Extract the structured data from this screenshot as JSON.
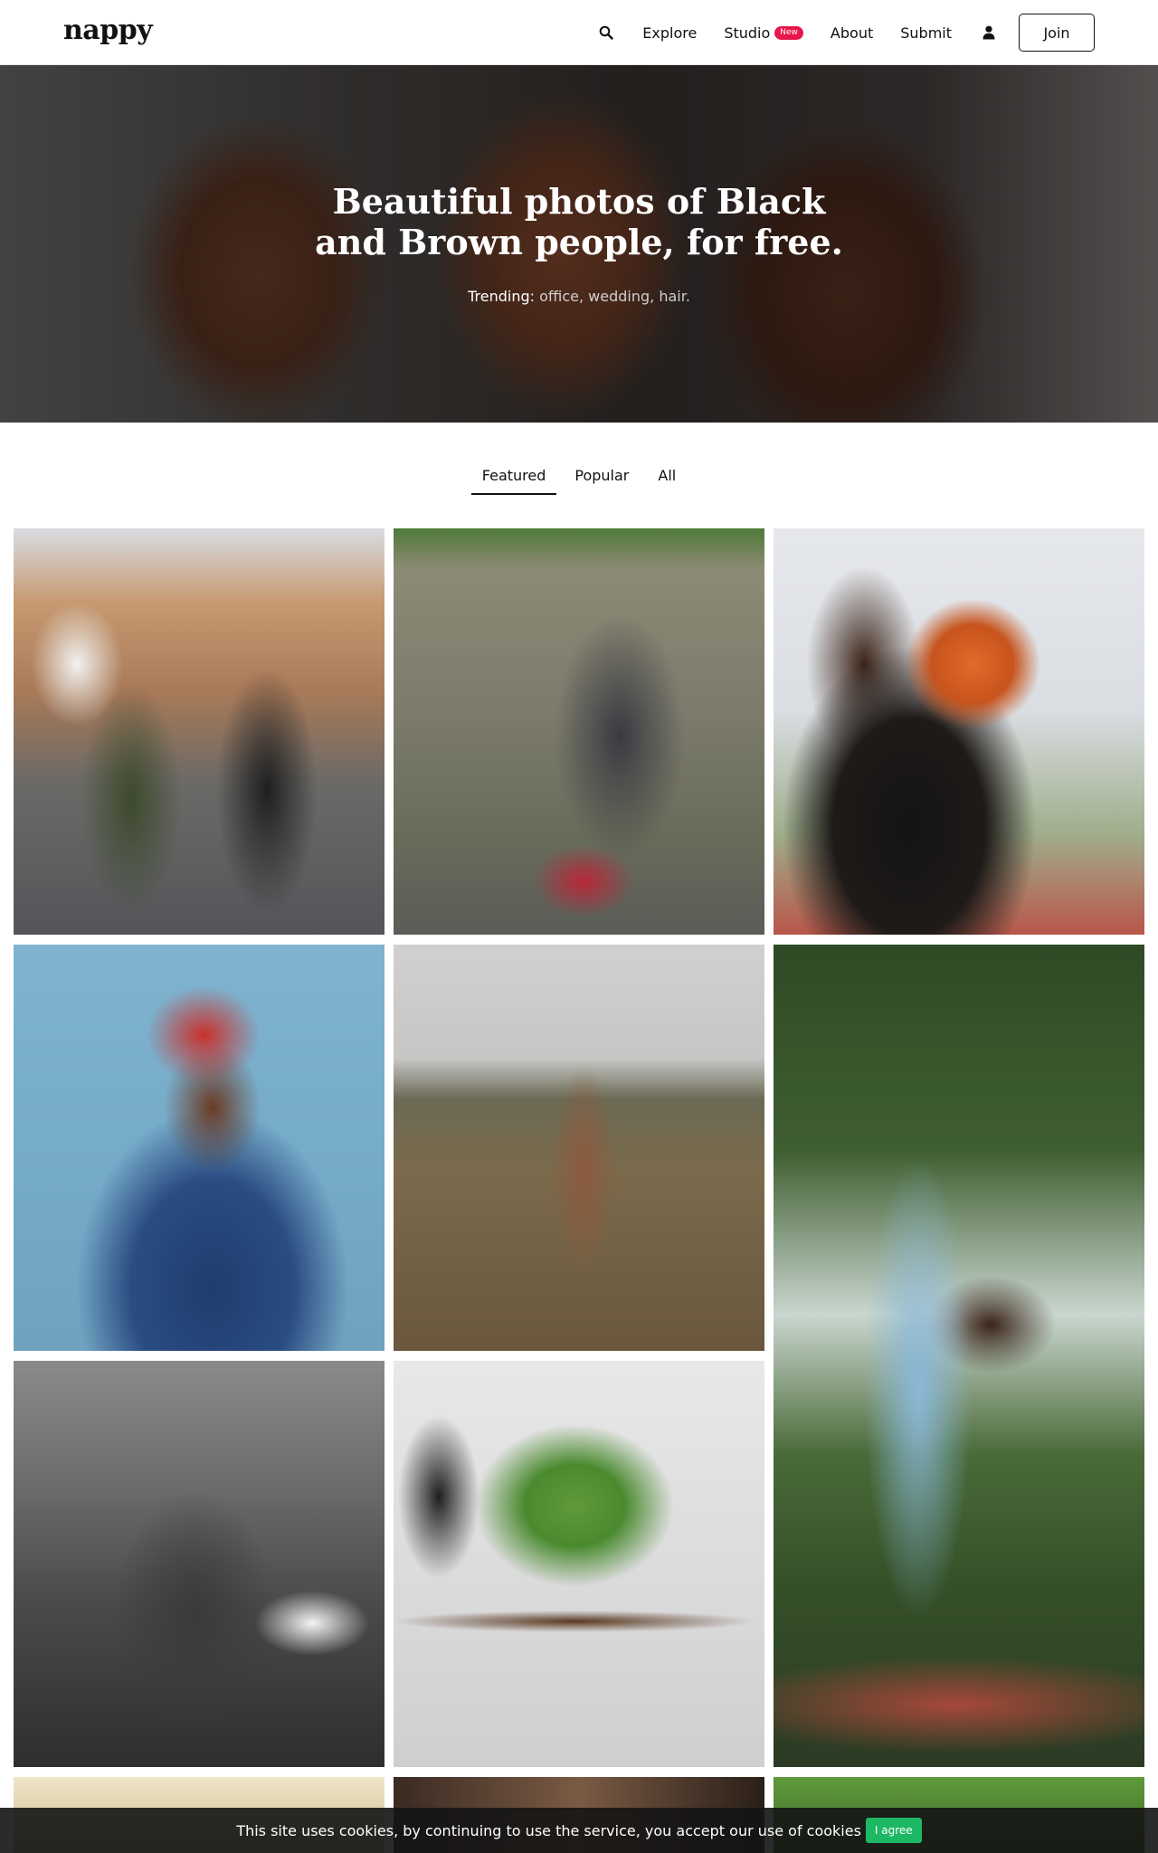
{
  "header": {
    "logo": "nappy",
    "nav": {
      "explore": "Explore",
      "studio": "Studio",
      "studio_badge": "New",
      "about": "About",
      "submit": "Submit",
      "join": "Join"
    },
    "icons": {
      "search": "search-icon",
      "user": "user-icon"
    }
  },
  "hero": {
    "title_line1": "Beautiful photos of Black",
    "title_line2": "and Brown people, for free.",
    "trending_label": "Trending:",
    "trending_terms": "office, wedding, hair."
  },
  "tabs": [
    {
      "label": "Featured",
      "active": true
    },
    {
      "label": "Popular",
      "active": false
    },
    {
      "label": "All",
      "active": false
    }
  ],
  "cookie": {
    "text": "This site uses cookies, by continuing to use the service, you accept our use of cookies",
    "button": "I agree"
  }
}
